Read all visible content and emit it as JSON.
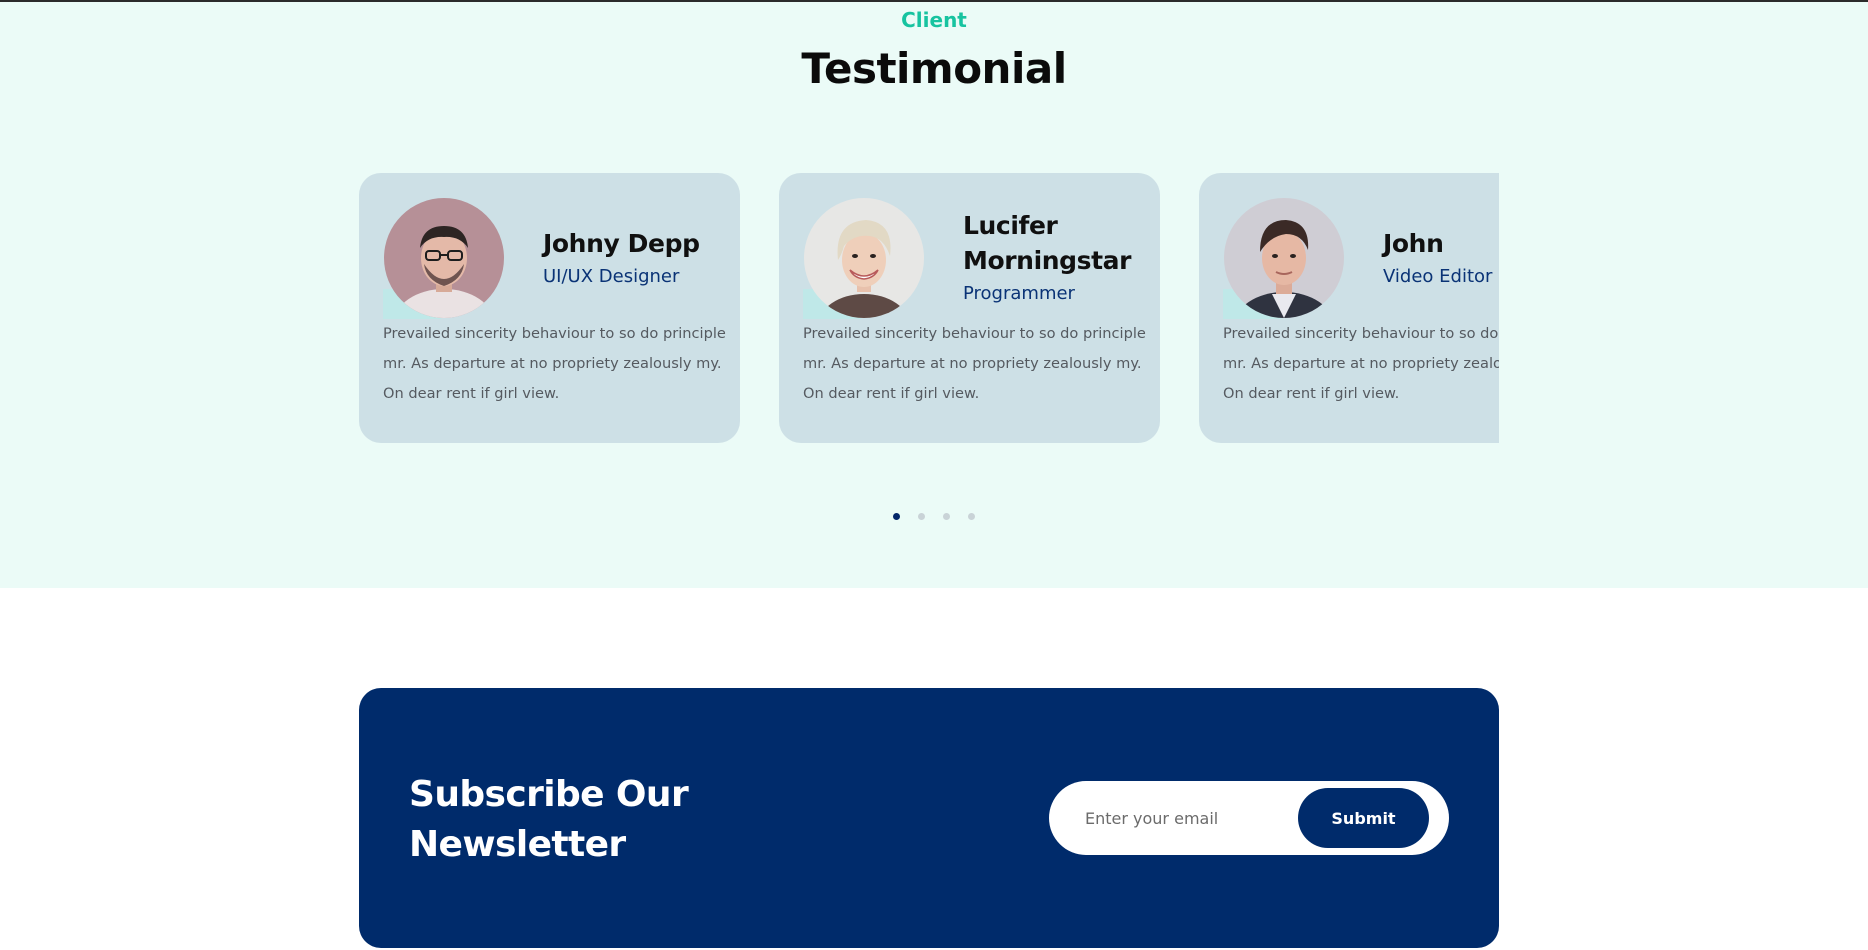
{
  "section": {
    "eyebrow": "Client",
    "title": "Testimonial"
  },
  "testimonials": [
    {
      "name": "Johny Depp",
      "role": "UI/UX Designer",
      "quote_lines": [
        "Prevailed sincerity behaviour to so do principle",
        "mr. As departure at no propriety zealously my.",
        "On dear rent if girl view."
      ]
    },
    {
      "name": "Lucifer Morningstar",
      "role": "Programmer",
      "quote_lines": [
        "Prevailed sincerity behaviour to so do principle",
        "mr. As departure at no propriety zealously my.",
        "On dear rent if girl view."
      ]
    },
    {
      "name": "John",
      "role": "Video Editor",
      "quote_lines": [
        "Prevailed sincerity behaviour to so do principle",
        "mr. As departure at no propriety zealously my.",
        "On dear rent if girl view."
      ]
    }
  ],
  "carousel": {
    "pages": 4,
    "active_page": 1
  },
  "newsletter": {
    "title": "Subscribe Our Newsletter",
    "email_placeholder": "Enter your email",
    "submit_label": "Submit"
  },
  "colors": {
    "accent_green": "#17c3a0",
    "brand_navy": "#002b6b",
    "section_bg": "#ebfbf7",
    "card_bg": "#cde0e6"
  }
}
